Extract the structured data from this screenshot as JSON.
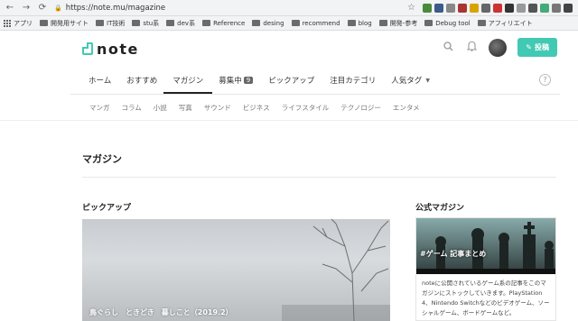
{
  "browser": {
    "url": "https://note.mu/magazine",
    "bookmarks": [
      "アプリ",
      "開発用サイト",
      "IT技術",
      "stu系",
      "dev系",
      "Reference",
      "desing",
      "recommend",
      "blog",
      "開発-参考",
      "Debug tool",
      "アフィリエイト"
    ]
  },
  "header": {
    "logo_text": "note",
    "post_label": "投稿"
  },
  "tabs": [
    {
      "label": "ホーム"
    },
    {
      "label": "おすすめ"
    },
    {
      "label": "マガジン",
      "active": true
    },
    {
      "label": "募集中",
      "badge": "9"
    },
    {
      "label": "ピックアップ"
    },
    {
      "label": "注目カテゴリ"
    },
    {
      "label": "人気タグ"
    }
  ],
  "subtabs": [
    "マンガ",
    "コラム",
    "小説",
    "写真",
    "サウンド",
    "ビジネス",
    "ライフスタイル",
    "テクノロジー",
    "エンタメ"
  ],
  "page_title": "マガジン",
  "pickup": {
    "heading": "ピックアップ",
    "hero_caption": "鳥ぐらし　ときどき　暮しこと（2019.2）"
  },
  "official": {
    "heading": "公式マガジン",
    "card_title": "#ゲーム 記事まとめ",
    "card_desc": "noteに公開されているゲーム系の記事をこのマガジンにストックしていきます。PlayStation 4、Nintendo Switchなどのビデオゲーム、ソーシャルゲーム、ボードゲームなど。"
  }
}
